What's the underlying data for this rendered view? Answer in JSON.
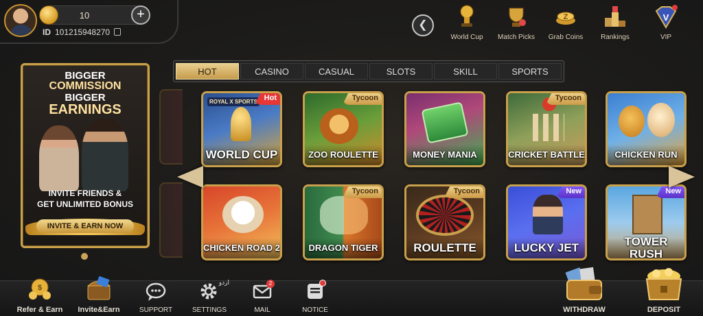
{
  "profile": {
    "balance": "10",
    "id_label": "ID",
    "id_value": "101215948270"
  },
  "top_nav": [
    {
      "label": "World Cup",
      "icon": "world-cup-trophy-icon"
    },
    {
      "label": "Match Picks",
      "icon": "match-picks-icon"
    },
    {
      "label": "Grab Coins",
      "icon": "grab-coins-icon"
    },
    {
      "label": "Rankings",
      "icon": "rankings-podium-icon"
    },
    {
      "label": "VIP",
      "icon": "vip-badge-icon"
    }
  ],
  "tabs": [
    {
      "label": "HOT",
      "active": true
    },
    {
      "label": "CASINO"
    },
    {
      "label": "CASUAL"
    },
    {
      "label": "SLOTS"
    },
    {
      "label": "SKILL"
    },
    {
      "label": "SPORTS"
    }
  ],
  "promo": {
    "line1": "BIGGER",
    "line2": "COMMISSION",
    "line3": "BIGGER",
    "line4": "EARNINGS",
    "sub1": "INVITE FRIENDS &",
    "sub2": "GET UNLIMITED BONUS",
    "button": "INVITE & EARN NOW"
  },
  "games": [
    {
      "name": "WORLD CUP",
      "badge": "Hot",
      "badge_type": "hot",
      "extra_text": "ROYAL X SPORTS",
      "colors": [
        "#2b4f8f",
        "#d9a53a"
      ]
    },
    {
      "name": "ZOO ROULETTE",
      "badge": "Tycoon",
      "badge_type": "tycoon",
      "colors": [
        "#2e6b2c",
        "#d68a2a"
      ]
    },
    {
      "name": "MONEY MANIA",
      "badge": "",
      "badge_type": "",
      "colors": [
        "#7a2f6e",
        "#3fae52"
      ]
    },
    {
      "name": "CRICKET BATTLE",
      "badge": "Tycoon",
      "badge_type": "tycoon",
      "colors": [
        "#3f6b3a",
        "#c89a5a"
      ]
    },
    {
      "name": "CHICKEN RUN",
      "badge": "",
      "badge_type": "",
      "colors": [
        "#3c7fd1",
        "#e6a53a"
      ]
    },
    {
      "name": "CHICKEN ROAD 2",
      "badge": "",
      "badge_type": "",
      "colors": [
        "#d8462a",
        "#f3c05a"
      ]
    },
    {
      "name": "DRAGON TIGER",
      "badge": "Tycoon",
      "badge_type": "tycoon",
      "colors": [
        "#2a6b3d",
        "#d8752a"
      ]
    },
    {
      "name": "ROULETTE",
      "badge": "Tycoon",
      "badge_type": "tycoon",
      "colors": [
        "#3a2a1a",
        "#8a5a2a"
      ]
    },
    {
      "name": "LUCKY JET",
      "badge": "New",
      "badge_type": "new",
      "colors": [
        "#3a4fd8",
        "#7a58d6"
      ]
    },
    {
      "name": "TOWER RUSH",
      "badge": "New",
      "badge_type": "new",
      "colors": [
        "#5aa6e0",
        "#c7a36a"
      ]
    }
  ],
  "bottom_nav": [
    {
      "label": "Refer & Earn",
      "icon": "refer-earn-icon"
    },
    {
      "label": "Invite&Earn",
      "icon": "invite-chest-icon"
    },
    {
      "label": "SUPPORT",
      "icon": "support-chat-icon"
    },
    {
      "label": "SETTINGS",
      "icon": "settings-gear-icon",
      "extra": "اردو"
    },
    {
      "label": "MAIL",
      "icon": "mail-icon",
      "badge": "2"
    },
    {
      "label": "NOTICE",
      "icon": "notice-icon"
    },
    {
      "label": "WITHDRAW",
      "icon": "withdraw-wallet-icon"
    },
    {
      "label": "DEPOSIT",
      "icon": "deposit-chest-icon"
    }
  ]
}
